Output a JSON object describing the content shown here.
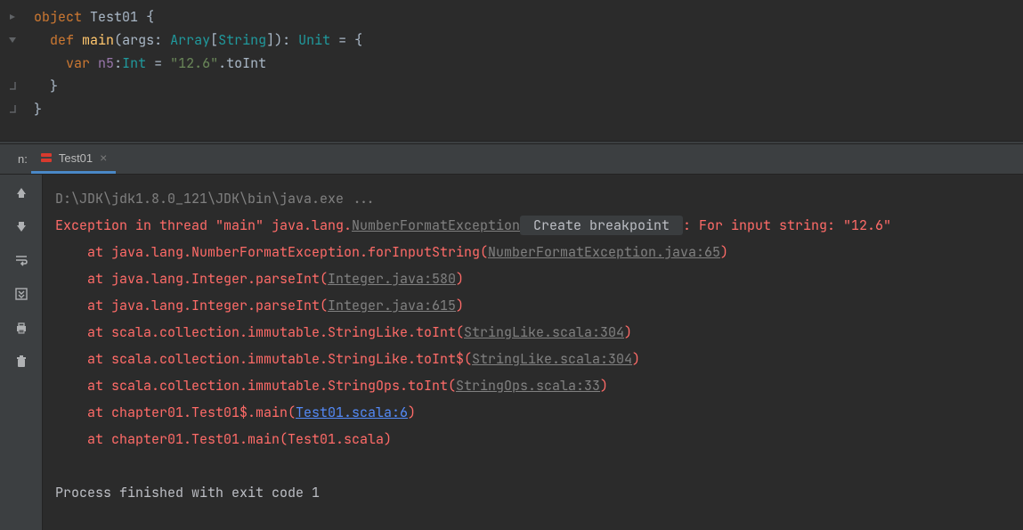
{
  "code": {
    "l1": {
      "kw": "object",
      "name": "Test01",
      "brace": "{"
    },
    "l2": {
      "kw1": "def",
      "fn": "main",
      "sig1": "(args: ",
      "ty1": "Array",
      "sig2": "[",
      "ty2": "String",
      "sig3": "]): ",
      "ty3": "Unit",
      "sig4": " = {"
    },
    "l3": {
      "kw": "var",
      "varname": "n5",
      "colon": ":",
      "ty": "Int",
      "eq": " = ",
      "str": "\"12.6\"",
      "call": ".toInt"
    },
    "l4": "}",
    "l5": "}"
  },
  "panel_label": "n:",
  "tab": {
    "title": "Test01"
  },
  "console": {
    "cmd": "D:\\JDK\\jdk1.8.0_121\\JDK\\bin\\java.exe ...",
    "exc_prefix": "Exception in thread \"main\" java.lang.",
    "exc_class": "NumberFormatException",
    "create_bp": " Create breakpoint ",
    "exc_suffix": ": For input string: \"12.6\"",
    "frames": [
      {
        "prefix": "    at java.lang.NumberFormatException.forInputString(",
        "link": "NumberFormatException.java:65",
        "suffix": ")"
      },
      {
        "prefix": "    at java.lang.Integer.parseInt(",
        "link": "Integer.java:580",
        "suffix": ")"
      },
      {
        "prefix": "    at java.lang.Integer.parseInt(",
        "link": "Integer.java:615",
        "suffix": ")"
      },
      {
        "prefix": "    at scala.collection.immutable.StringLike.toInt(",
        "link": "StringLike.scala:304",
        "suffix": ")"
      },
      {
        "prefix": "    at scala.collection.immutable.StringLike.toInt$(",
        "link": "StringLike.scala:304",
        "suffix": ")"
      },
      {
        "prefix": "    at scala.collection.immutable.StringOps.toInt(",
        "link": "StringOps.scala:33",
        "suffix": ")"
      },
      {
        "prefix": "    at chapter01.Test01$.main(",
        "mylink": "Test01.scala:6",
        "suffix": ")"
      },
      {
        "prefix": "    at chapter01.Test01.main(Test01.scala)",
        "plain": true
      }
    ],
    "exit": "Process finished with exit code 1"
  }
}
